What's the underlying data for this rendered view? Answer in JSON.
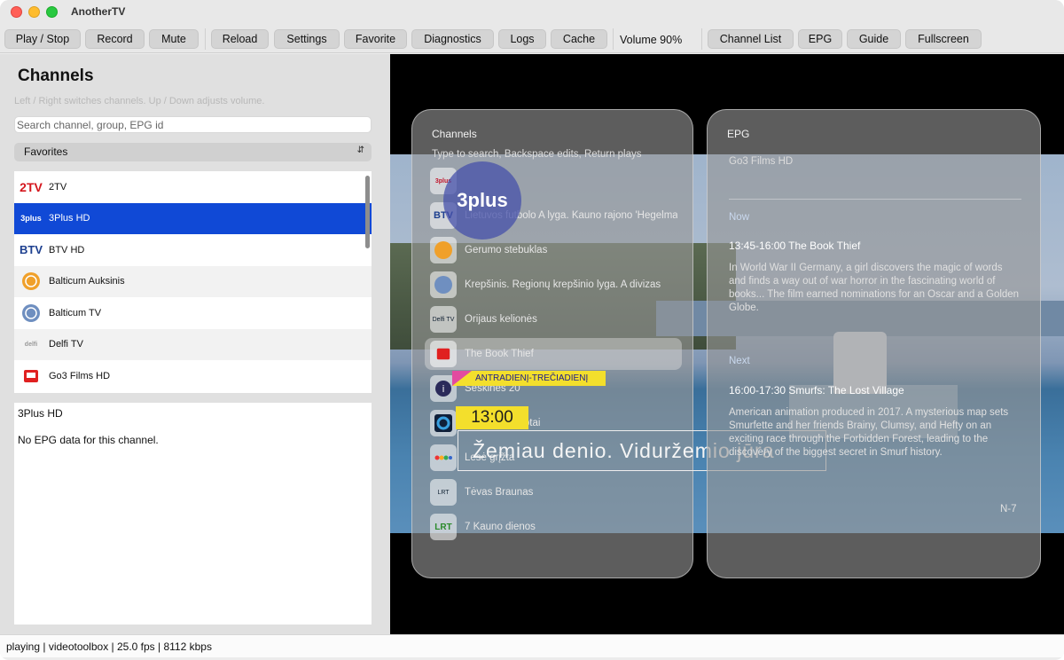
{
  "app": {
    "title": "AnotherTV"
  },
  "toolbar": {
    "play_stop": "Play / Stop",
    "record": "Record",
    "mute": "Mute",
    "reload": "Reload",
    "settings": "Settings",
    "favorite": "Favorite",
    "diagnostics": "Diagnostics",
    "logs": "Logs",
    "cache": "Cache",
    "volume": "Volume 90%",
    "channel_list": "Channel List",
    "epg": "EPG",
    "guide": "Guide",
    "fullscreen": "Fullscreen"
  },
  "sidebar": {
    "title": "Channels",
    "hint": "Left / Right switches channels. Up / Down adjusts volume.",
    "search_placeholder": "Search channel, group, EPG id",
    "group_select": "Favorites",
    "channels": [
      {
        "name": "2TV",
        "logo": "2TV"
      },
      {
        "name": "3Plus HD",
        "logo": "3plus"
      },
      {
        "name": "BTV HD",
        "logo": "BTV"
      },
      {
        "name": "Balticum Auksinis",
        "logo": "balticum-gold-icon"
      },
      {
        "name": "Balticum TV",
        "logo": "balticum-icon"
      },
      {
        "name": "Delfi TV",
        "logo": "delfi"
      },
      {
        "name": "Go3 Films HD",
        "logo": "go3-films-icon"
      }
    ],
    "selected_index": 1
  },
  "epg_panel": {
    "channel": "3Plus HD",
    "message": "No EPG data for this channel."
  },
  "overlay_channels": {
    "title": "Channels",
    "hint": "Type to search, Backspace edits, Return plays",
    "items": [
      {
        "logo": "3plus",
        "text": ""
      },
      {
        "logo": "BTV",
        "text": "Lietuvos futbolo A lyga. Kauno rajono 'Hegelmann'"
      },
      {
        "logo": "balticum-gold-icon",
        "text": "Gerumo stebuklas"
      },
      {
        "logo": "balticum-icon",
        "text": "Krepšinis. Regionų krepšinio lyga. A divizas"
      },
      {
        "logo": "Delfi TV",
        "text": "Orijaus kelionės"
      },
      {
        "logo": "go3",
        "text": "The Book Thief"
      },
      {
        "logo": "info-icon",
        "text": "Šeškinės 20"
      },
      {
        "logo": "circle-icon",
        "text": "Vasaros receptai"
      },
      {
        "logo": "peacock-icon",
        "text": "Lesė grįžta"
      },
      {
        "logo": "LRT",
        "text": "Tėvas Braunas"
      },
      {
        "logo": "LRT",
        "text": "7 Kauno dienos"
      }
    ],
    "selected_index": 5
  },
  "overlay_epg": {
    "title": "EPG",
    "channel": "Go3 Films HD",
    "now_label": "Now",
    "now_title": "13:45-16:00  The Book Thief",
    "now_desc": "In World War II Germany, a girl discovers the magic of words and finds a way out of war horror in the fascinating world of books... The film earned nominations for an Oscar and a Golden Globe.",
    "next_label": "Next",
    "next_title": "16:00-17:30  Smurfs: The Lost Village",
    "next_desc": "American animation produced in 2017. A mysterious map sets Smurfette and her friends Brainy, Clumsy, and Hefty on an exciting race through the Forbidden Forest, leading to the discovery of the biggest secret in Smurf history.",
    "rating": "N-7"
  },
  "video_overlay": {
    "bubble": "3plus",
    "days": "ANTRADIENĮ-TREČIADIENĮ",
    "time": "13:00",
    "headline": "Žemiau denio. Viduržemio jūra"
  },
  "status": {
    "text": "playing | videotoolbox | 25.0 fps | 8112 kbps"
  },
  "colors": {
    "selection": "#1049d6",
    "accent_yellow": "#f3df2c",
    "accent_pink": "#e24aa0"
  }
}
